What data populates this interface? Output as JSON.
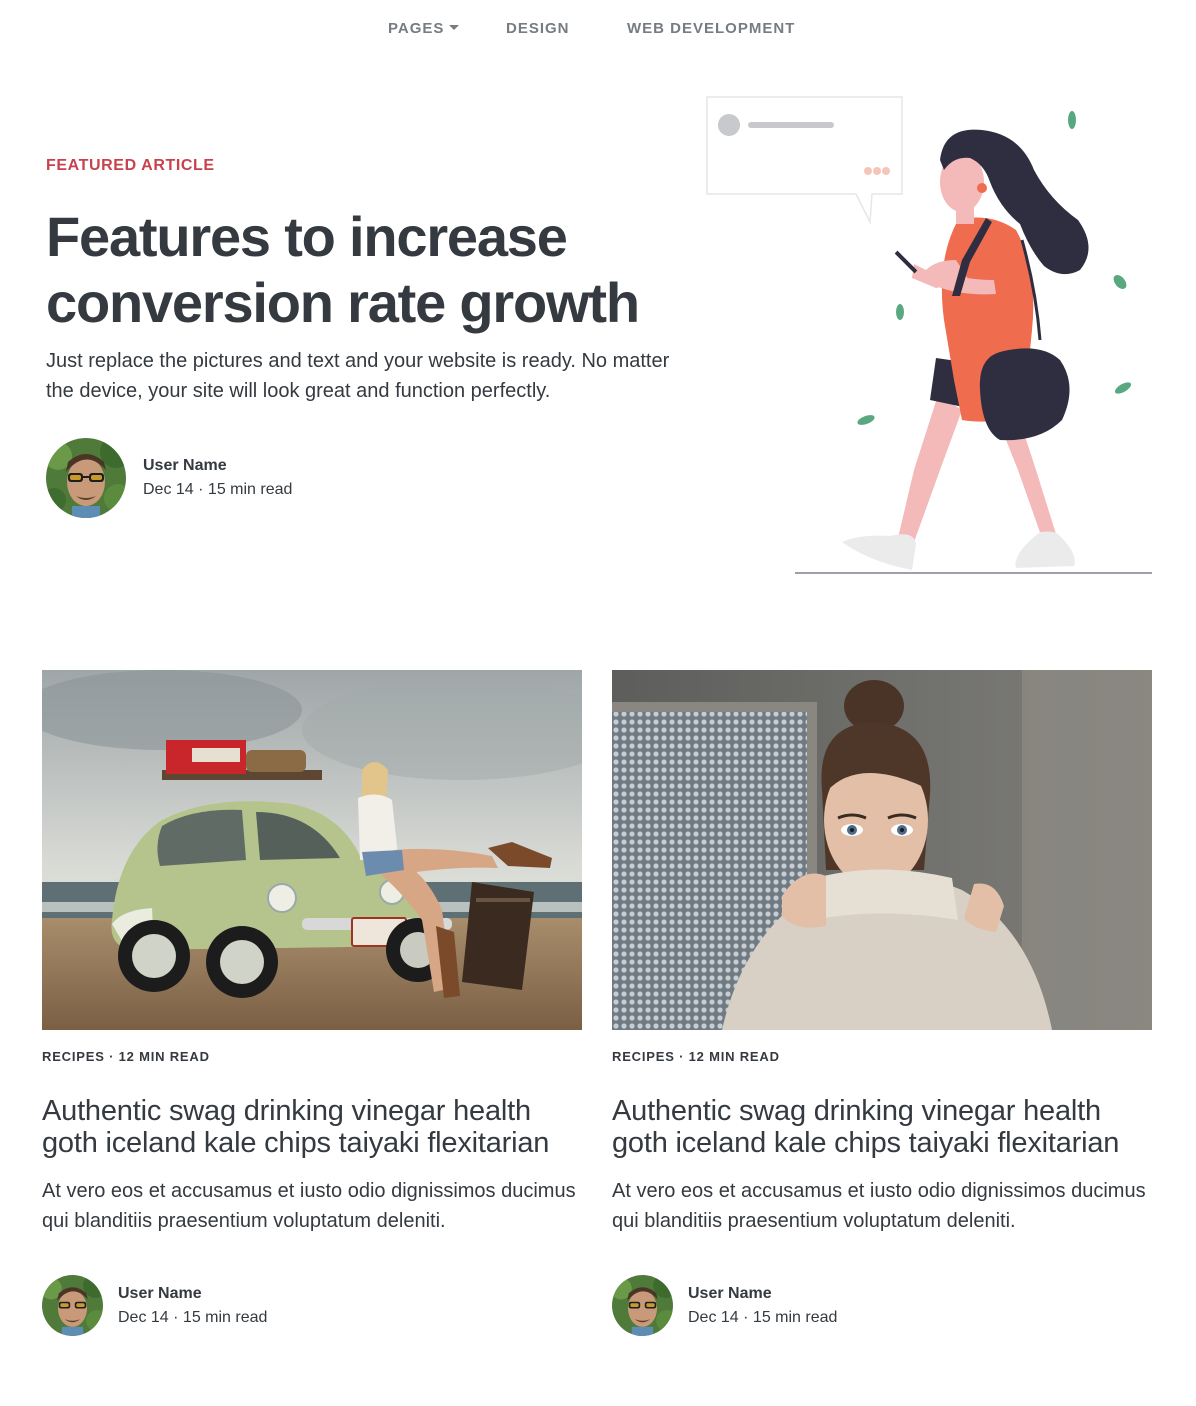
{
  "nav": {
    "pages": "PAGES",
    "design": "DESIGN",
    "web_development": "WEB DEVELOPMENT"
  },
  "hero": {
    "eyebrow": "FEATURED ARTICLE",
    "title": "Features to increase conversion rate growth",
    "description": "Just replace the pictures and text and your website is ready. No matter the device, your site will look great and function perfectly.",
    "author": {
      "name": "User Name",
      "meta": "Dec 14 · 15 min read"
    }
  },
  "cards": [
    {
      "meta": "RECIPES · 12 MIN READ",
      "title": "Authentic swag drinking vinegar health goth iceland kale chips taiyaki flexitarian",
      "text": "At vero eos et accusamus et iusto odio dignissimos ducimus qui blanditiis praesentium voluptatum deleniti.",
      "author": {
        "name": "User Name",
        "meta": "Dec 14 · 15 min read"
      },
      "image": "vintage-car-beach-photo"
    },
    {
      "meta": "RECIPES · 12 MIN READ",
      "title": "Authentic swag drinking vinegar health goth iceland kale chips taiyaki flexitarian",
      "text": "At vero eos et accusamus et iusto odio dignissimos ducimus qui blanditiis praesentium voluptatum deleniti.",
      "author": {
        "name": "User Name",
        "meta": "Dec 14 · 15 min read"
      },
      "image": "woman-sweater-portrait-photo"
    }
  ],
  "colors": {
    "accent": "#c8424e",
    "text": "#343a40",
    "nav": "#777c82",
    "illustration_orange": "#ef6c4f",
    "illustration_dark": "#2f2e41",
    "illustration_skin": "#f4b9b9",
    "leaf": "#5aa882"
  }
}
